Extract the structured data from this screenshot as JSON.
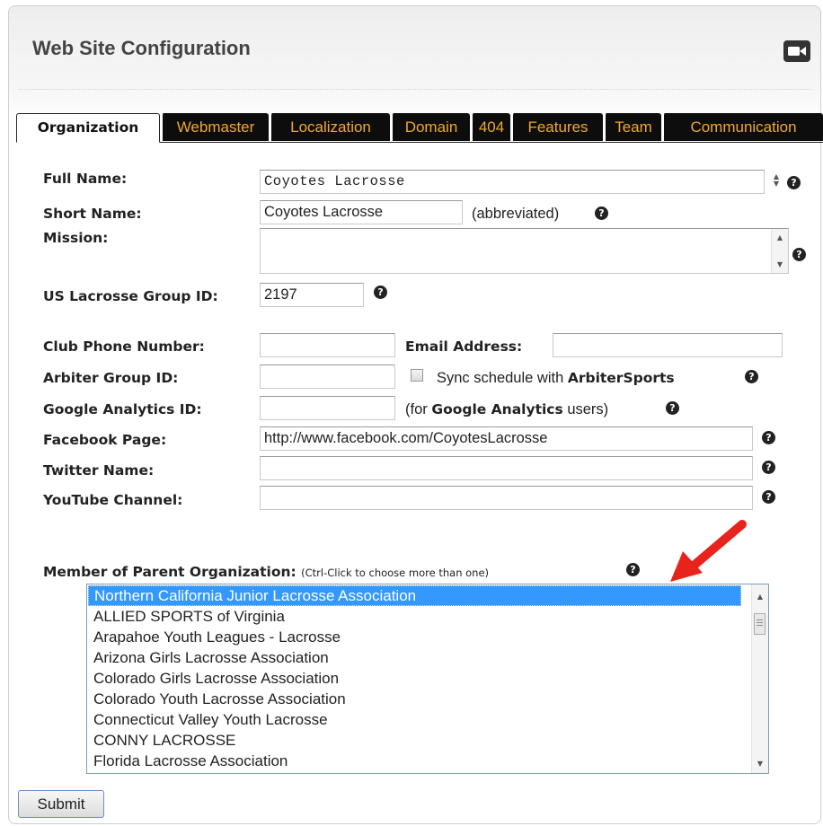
{
  "header": {
    "title": "Web Site Configuration",
    "video_icon": "video-camera-icon"
  },
  "tabs": [
    {
      "label": "Organization",
      "active": true
    },
    {
      "label": "Webmaster"
    },
    {
      "label": "Localization"
    },
    {
      "label": "Domain"
    },
    {
      "label": "404"
    },
    {
      "label": "Features"
    },
    {
      "label": "Team"
    },
    {
      "label": "Communication"
    }
  ],
  "form": {
    "full_name": {
      "label": "Full Name:",
      "value": "Coyotes Lacrosse"
    },
    "short_name": {
      "label": "Short Name:",
      "value": "Coyotes Lacrosse",
      "note": "(abbreviated)"
    },
    "mission": {
      "label": "Mission:",
      "value": ""
    },
    "us_lacrosse_id": {
      "label": "US Lacrosse Group ID:",
      "value": "2197"
    },
    "club_phone": {
      "label": "Club Phone Number:",
      "value": ""
    },
    "email": {
      "label": "Email Address:",
      "value": ""
    },
    "arbiter_id": {
      "label": "Arbiter Group ID:",
      "value": ""
    },
    "sync": {
      "text": "Sync schedule with ",
      "brand": "ArbiterSports",
      "checked": false
    },
    "google_analytics": {
      "label": "Google Analytics ID:",
      "value": "",
      "note_prefix": "(for ",
      "note_brand": "Google Analytics",
      "note_suffix": " users)"
    },
    "facebook": {
      "label": "Facebook Page:",
      "value": "http://www.facebook.com/CoyotesLacrosse"
    },
    "twitter": {
      "label": "Twitter Name:",
      "value": ""
    },
    "youtube": {
      "label": "YouTube Channel:",
      "value": ""
    },
    "parent_org": {
      "label": "Member of Parent Organization:",
      "hint": "(Ctrl-Click to choose more than one)",
      "options": [
        "Northern California Junior Lacrosse Association",
        "ALLIED SPORTS of Virginia",
        "Arapahoe Youth Leagues - Lacrosse",
        "Arizona Girls Lacrosse Association",
        "Colorado Girls Lacrosse Association",
        "Colorado Youth Lacrosse Association",
        "Connecticut Valley Youth Lacrosse",
        "CONNY LACROSSE",
        "Florida Lacrosse Association"
      ],
      "selected": "Northern California Junior Lacrosse Association"
    }
  },
  "help_glyph": "?",
  "submit_label": "Submit",
  "colors": {
    "tab_bg": "#0d0d0d",
    "tab_text": "#f0a830",
    "selection": "#3399ff",
    "annotation_arrow": "#e8231c"
  }
}
